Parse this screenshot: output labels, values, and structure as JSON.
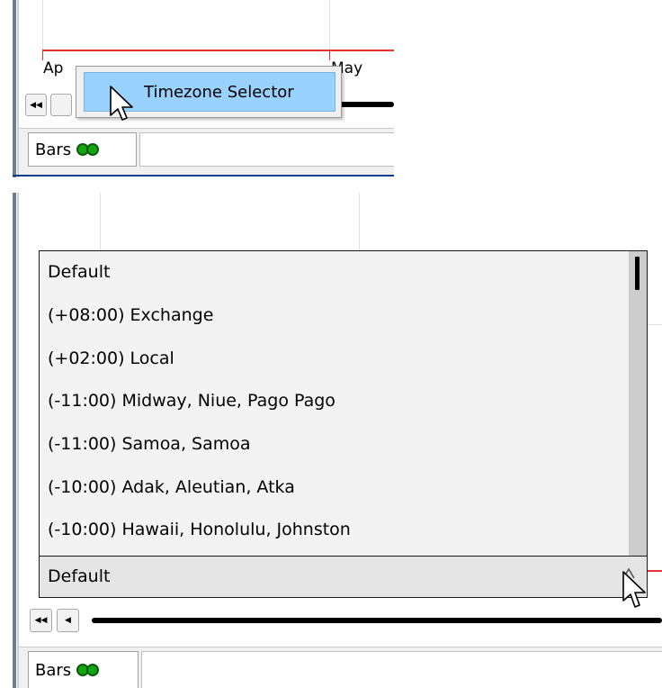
{
  "top_panel": {
    "axis_labels": [
      "Ap",
      "May"
    ],
    "context_menu": {
      "item_label": "Timezone Selector"
    },
    "scroll_left_icon": "double-left-arrow",
    "status_tab": {
      "label": "Bars"
    }
  },
  "bottom_panel": {
    "timezone_dropdown": {
      "options": [
        "Default",
        "(+08:00) Exchange",
        "(+02:00) Local",
        "(-11:00) Midway, Niue, Pago Pago",
        "(-11:00) Samoa, Samoa",
        "(-10:00) Adak, Aleutian, Atka",
        "(-10:00) Hawaii, Honolulu, Johnston"
      ],
      "selected_value": "Default"
    },
    "scroll_icons": [
      "double-left-arrow",
      "left-arrow"
    ],
    "status_tab": {
      "label": "Bars"
    }
  },
  "colors": {
    "menu_highlight": "#99d1ff",
    "axis_red": "#e53333",
    "status_green": "#14a514",
    "accent_blue": "#0a3f8a"
  }
}
